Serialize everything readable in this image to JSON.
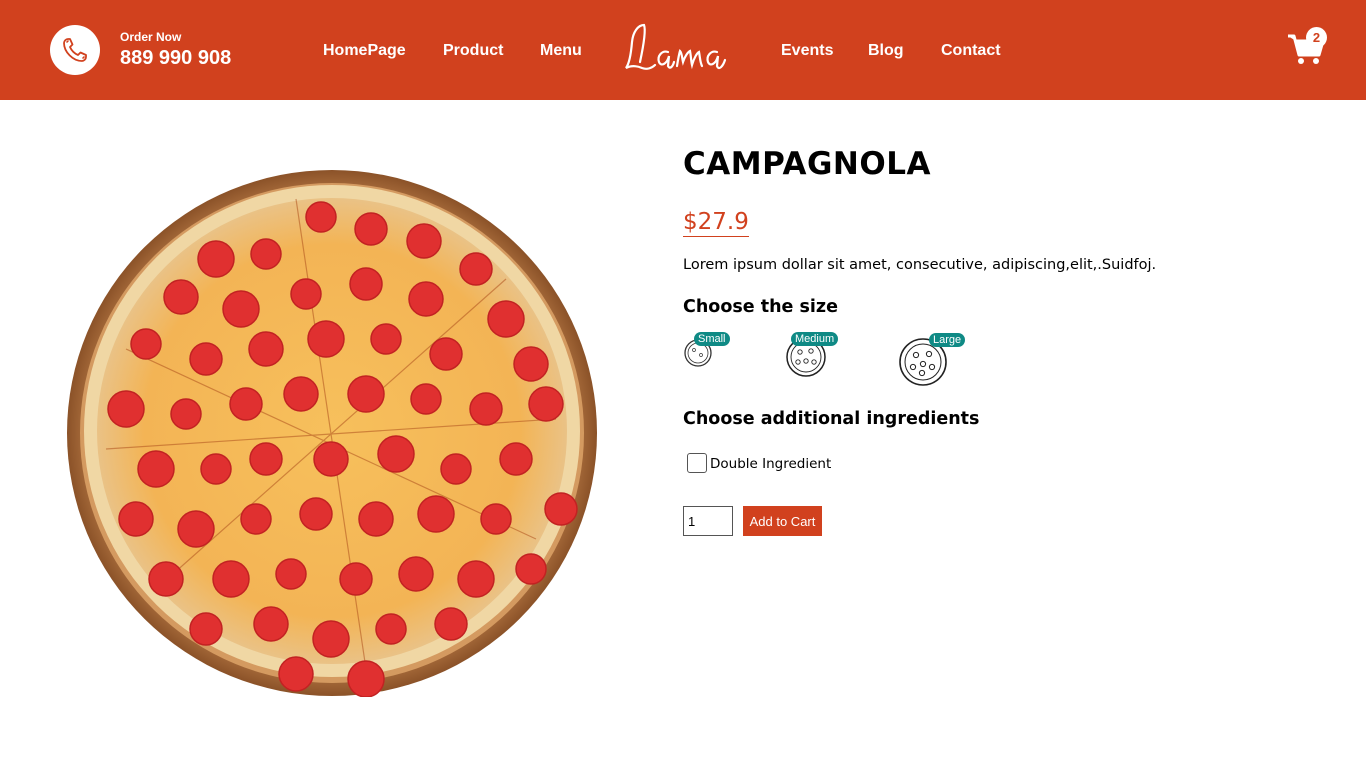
{
  "navbar": {
    "order_label": "Order Now",
    "phone": "889 990 908",
    "links": [
      "HomePage",
      "Product",
      "Menu",
      "Events",
      "Blog",
      "Contact"
    ],
    "logo_text": "Lama",
    "cart_count": "2",
    "icons": {
      "call": "telephone-icon",
      "cart": "shopping-cart-icon"
    },
    "bg_color": "#d1411e"
  },
  "product": {
    "title": "CAMPAGNOLA",
    "price": "$27.9",
    "description": "Lorem ipsum dollar sit amet, consecutive, adipiscing,elit,.Suidfoj.",
    "image": "pepperoni-pizza-image"
  },
  "size_section": {
    "heading": "Choose the size",
    "sizes": [
      "Small",
      "Medium",
      "Large"
    ]
  },
  "ingredients_section": {
    "heading": "Choose additional ingredients",
    "options": [
      {
        "label": "Double Ingredient",
        "checked": false
      }
    ]
  },
  "cart_form": {
    "quantity": "1",
    "button_label": "Add to Cart"
  },
  "colors": {
    "accent": "#d1411e",
    "badge": "#0f8a85"
  }
}
